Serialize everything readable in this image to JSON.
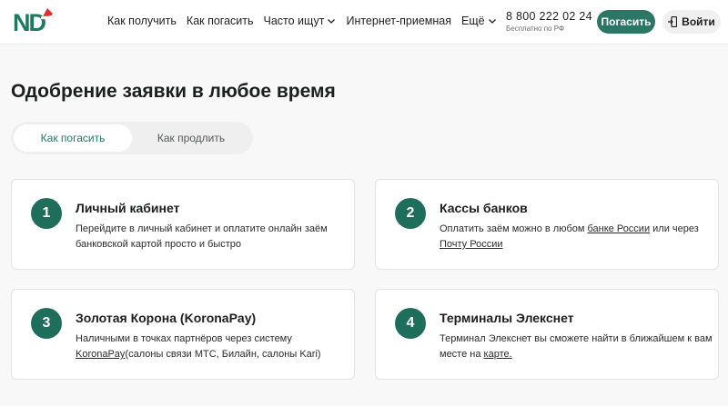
{
  "brand": {
    "logo_text": "ND",
    "accent": "#2b7664",
    "num_bg": "#1f6e5c"
  },
  "nav": {
    "items": [
      {
        "label": "Как получить",
        "dropdown": false
      },
      {
        "label": "Как погасить",
        "dropdown": false
      },
      {
        "label": "Часто ищут",
        "dropdown": true
      },
      {
        "label": "Интернет-приемная",
        "dropdown": false
      },
      {
        "label": "Ещё",
        "dropdown": true
      }
    ]
  },
  "contact": {
    "phone": "8 800 222 02 24",
    "phone_note": "Бесплатно по РФ"
  },
  "header_buttons": {
    "pay": "Погасить",
    "login": "Войти"
  },
  "main": {
    "title": "Одобрение заявки в любое время",
    "tabs": [
      {
        "label": "Как погасить",
        "active": true
      },
      {
        "label": "Как продлить",
        "active": false
      }
    ],
    "cards": [
      {
        "num": "1",
        "title": "Личный кабинет",
        "text": "Перейдите в личный кабинет и оплатите онлайн заём банковской картой просто и быстро"
      },
      {
        "num": "2",
        "title": "Кассы банков",
        "text_a": "Оплатить заём можно в любом ",
        "link_a": "банке России",
        "text_b": " или через ",
        "link_b": "Почту России"
      },
      {
        "num": "3",
        "title": "Золотая Корона (KoronaPay)",
        "text_a": "Наличными в точках партнёров через систему ",
        "link_a": "KoronaPay",
        "text_b": "(салоны связи МТС, Билайн, салоны Kari)"
      },
      {
        "num": "4",
        "title": "Терминалы Элекснет",
        "text_a": "Терминал Элекснет вы сможете найти в ближайшем к вам месте на ",
        "link_a": "карте."
      }
    ]
  }
}
